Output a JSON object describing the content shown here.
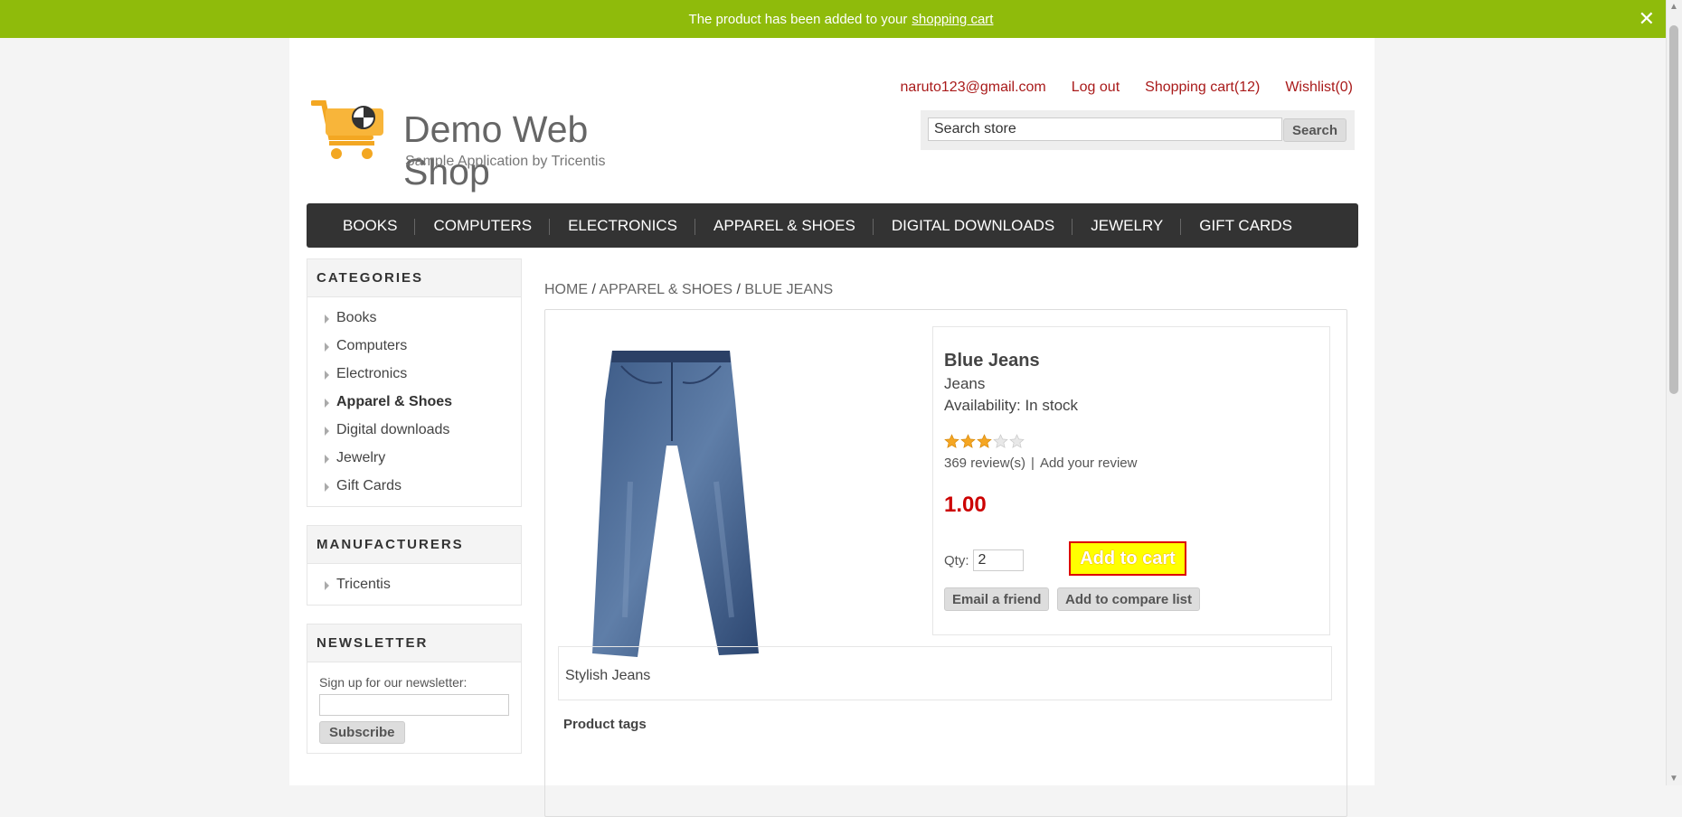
{
  "notification": {
    "text": "The product has been added to your",
    "link": "shopping cart",
    "close_glyph": "✕"
  },
  "header": {
    "brand": "Demo Web Shop",
    "tagline": "Sample Application by Tricentis",
    "links": {
      "account": "naruto123@gmail.com",
      "logout": "Log out",
      "cart": "Shopping cart(12)",
      "wishlist": "Wishlist(0)"
    },
    "search": {
      "value": "Search store",
      "button": "Search"
    }
  },
  "menu": [
    "BOOKS",
    "COMPUTERS",
    "ELECTRONICS",
    "APPAREL & SHOES",
    "DIGITAL DOWNLOADS",
    "JEWELRY",
    "GIFT CARDS"
  ],
  "sidebar": {
    "categories_title": "CATEGORIES",
    "categories": [
      "Books",
      "Computers",
      "Electronics",
      "Apparel & Shoes",
      "Digital downloads",
      "Jewelry",
      "Gift Cards"
    ],
    "active_category": "Apparel & Shoes",
    "manufacturers_title": "MANUFACTURERS",
    "manufacturers": [
      "Tricentis"
    ],
    "newsletter_title": "NEWSLETTER",
    "newsletter_label": "Sign up for our newsletter:",
    "subscribe": "Subscribe"
  },
  "breadcrumb": {
    "home": "HOME",
    "category": "APPAREL & SHOES",
    "current": "BLUE JEANS",
    "sep": " / "
  },
  "product": {
    "name": "Blue Jeans",
    "short_desc": "Jeans",
    "availability": "Availability: In stock",
    "rating": 3,
    "rating_max": 5,
    "reviews": "369 review(s)",
    "review_sep": "|",
    "add_review": "Add your review",
    "price": "1.00",
    "qty_label": "Qty:",
    "qty_value": "2",
    "add_to_cart": "Add to cart",
    "email_friend": "Email a friend",
    "compare": "Add to compare list",
    "full_desc": "Stylish Jeans",
    "next_label": "Product tags"
  },
  "colors": {
    "notification": "#8fbb0b",
    "link": "#a91a1a",
    "price": "#cc0000",
    "menu_bg": "#333333"
  }
}
